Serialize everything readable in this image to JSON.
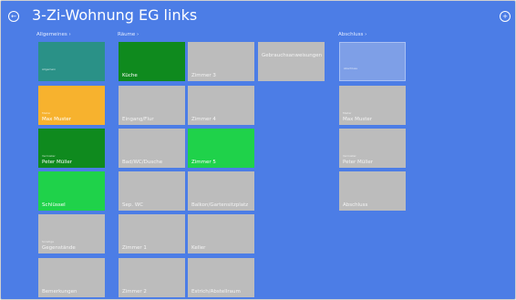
{
  "header": {
    "title": "3-Zi-Wohnung EG links",
    "back_icon": "arrow-left-circle-icon",
    "add_icon": "plus-circle-icon",
    "back_glyph": "←",
    "add_glyph": "+"
  },
  "colors": {
    "background": "#4c7de6",
    "teal": "#2a9187",
    "orange": "#f7b22e",
    "dark_green": "#0f8a1e",
    "bright_green": "#1fd24a",
    "gray": "#bcbcbc",
    "faded": "#7e9fe7"
  },
  "groups": {
    "allgemein": {
      "header": "Allgemeines ›",
      "tiles": [
        {
          "sub": "Allgemein",
          "label": ""
        },
        {
          "sub": "Mieter",
          "label": "Max Muster"
        },
        {
          "sub": "Vermieter",
          "label": "Peter Müller"
        },
        {
          "sub": "",
          "label": "Schlüssel"
        },
        {
          "sub": "Sonstige",
          "label": "Gegenstände"
        },
        {
          "sub": "",
          "label": "Bemerkungen"
        }
      ]
    },
    "raeume": {
      "header": "Räume ›",
      "tiles": [
        {
          "label": "Küche"
        },
        {
          "label": "Zimmer 3"
        },
        {
          "label": "Gebrauchsanweisungen"
        },
        {
          "label": "Eingang/Flur"
        },
        {
          "label": "Zimmer 4"
        },
        {
          "label": "Bad/WC/Dusche"
        },
        {
          "label": "Zimmer 5"
        },
        {
          "label": "Sep. WC"
        },
        {
          "label": "Balkon/Gartensitzplatz"
        },
        {
          "label": "Zimmer 1"
        },
        {
          "label": "Keller"
        },
        {
          "label": "Zimmer 2"
        },
        {
          "label": "Estrich/Abstellraum"
        }
      ]
    },
    "abschluss": {
      "header": "Abschluss ›",
      "tiles": [
        {
          "sub": "Abschluss",
          "label": ""
        },
        {
          "sub": "Mieter",
          "label": "Max Muster"
        },
        {
          "sub": "Vermieter",
          "label": "Peter Müller"
        },
        {
          "sub": "",
          "label": "Abschluss"
        }
      ]
    }
  }
}
